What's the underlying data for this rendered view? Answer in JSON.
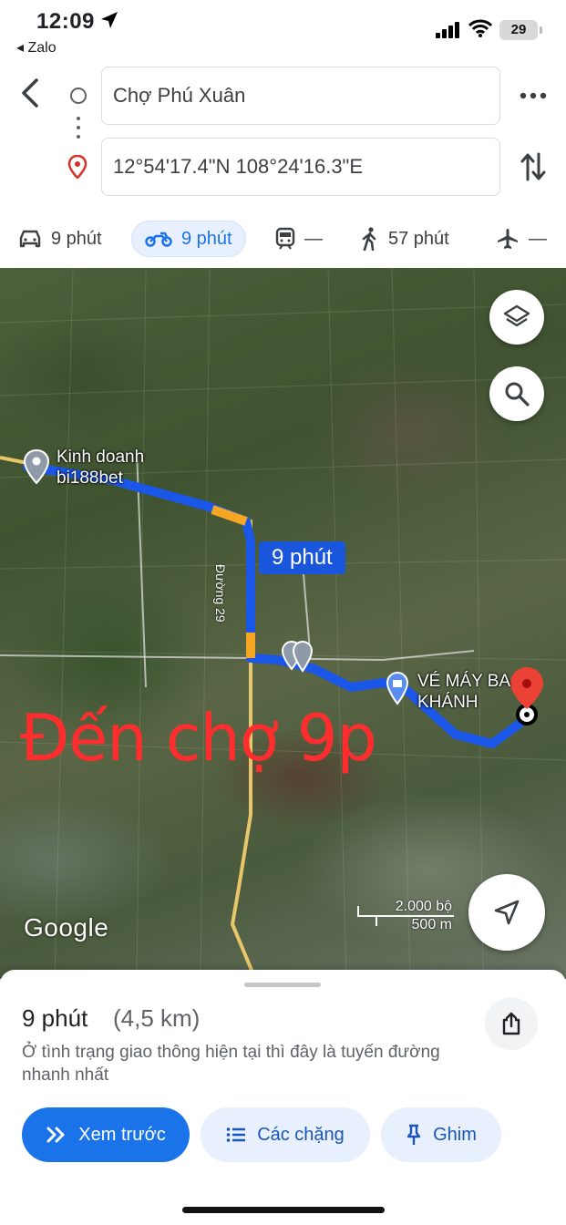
{
  "status_bar": {
    "time": "12:09",
    "back_app": "◂ Zalo",
    "battery": "29"
  },
  "route": {
    "origin": "Chợ Phú Xuân",
    "destination": "12°54'17.4\"N 108°24'16.3\"E"
  },
  "modes": [
    {
      "name": "car",
      "label": "9 phút"
    },
    {
      "name": "motorbike",
      "label": "9 phút",
      "active": true
    },
    {
      "name": "transit",
      "label": "—"
    },
    {
      "name": "walk",
      "label": "57 phút"
    },
    {
      "name": "flight",
      "label": "—"
    }
  ],
  "map": {
    "overlay_text": "Đến chợ 9p",
    "route_time_label": "9 phút",
    "road_label": "Đường 29",
    "places": [
      {
        "name": "Kinh doanh\nbi188bet"
      },
      {
        "name": "VÉ MÁY BA\nKHÁNH"
      }
    ],
    "place1_line1": "Kinh doanh",
    "place1_line2": "bi188bet",
    "place2_line1": "VÉ MÁY BA",
    "place2_line2": "KHÁNH",
    "attribution": "Google",
    "scale_top": "2.000 bộ",
    "scale_bottom": "500 m"
  },
  "sheet": {
    "eta": "9 phút",
    "distance": "(4,5 km)",
    "description": "Ở tình trạng giao thông hiện tại thì đây là tuyến đường nhanh nhất",
    "preview_label": "Xem trước",
    "steps_label": "Các chặng",
    "pin_label": "Ghim"
  },
  "colors": {
    "accent": "#1a73e8",
    "route": "#1a56e8",
    "overlay_text": "#ff2d2d",
    "destination_pin": "#ea4335"
  }
}
